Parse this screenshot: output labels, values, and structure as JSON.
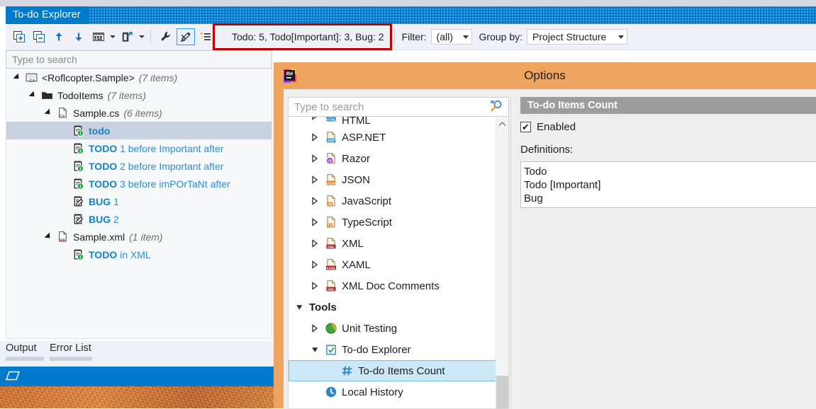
{
  "vs_window": {
    "title": "To-do Explorer",
    "toolbar": {
      "buttons": [
        {
          "name": "expand-all-icon",
          "label": "Expand All"
        },
        {
          "name": "collapse-all-icon",
          "label": "Collapse All"
        },
        {
          "name": "previous-item-icon",
          "label": "Previous Item"
        },
        {
          "name": "next-item-icon",
          "label": "Next Item"
        },
        {
          "name": "grouping-icon",
          "label": "Grouping"
        },
        {
          "name": "export-icon",
          "label": "Export"
        },
        {
          "name": "settings-wrench-icon",
          "label": "Settings"
        },
        {
          "name": "highlight-marker-icon",
          "label": "Highlight"
        },
        {
          "name": "sparkle-list-icon",
          "label": "Show Items"
        }
      ],
      "count_text": "Todo: 5, Todo[Important]: 3, Bug: 2",
      "filter_label": "Filter:",
      "filter_value": "(all)",
      "group_by_label": "Group by:",
      "group_by_value": "Project Structure"
    },
    "search": {
      "placeholder": "Type to search",
      "value": ""
    },
    "tree": [
      {
        "depth": 0,
        "twist": "open",
        "icon": "csharp-project-icon",
        "label": "<Roflcopter.Sample>",
        "meta": "(7 items)",
        "style": "plain",
        "selected": false
      },
      {
        "depth": 1,
        "twist": "open",
        "icon": "folder-icon",
        "label": "TodoItems",
        "meta": "(7 items)",
        "style": "plain",
        "selected": false
      },
      {
        "depth": 2,
        "twist": "open",
        "icon": "csharp-file-icon",
        "label": "Sample.cs",
        "meta": "(6 items)",
        "style": "plain",
        "selected": false
      },
      {
        "depth": 3,
        "twist": "none",
        "icon": "todo-item-icon",
        "keyword": "todo",
        "rest": "",
        "meta": "",
        "style": "todo",
        "selected": true
      },
      {
        "depth": 3,
        "twist": "none",
        "icon": "todo-item-icon",
        "keyword": "TODO",
        "rest": "1 before Important after",
        "meta": "",
        "style": "todo",
        "selected": false
      },
      {
        "depth": 3,
        "twist": "none",
        "icon": "todo-item-icon",
        "keyword": "TODO",
        "rest": "2 before Important after",
        "meta": "",
        "style": "todo",
        "selected": false
      },
      {
        "depth": 3,
        "twist": "none",
        "icon": "todo-item-icon",
        "keyword": "TODO",
        "rest": "3 before imPOrTaNt after",
        "meta": "",
        "style": "todo",
        "selected": false
      },
      {
        "depth": 3,
        "twist": "none",
        "icon": "bug-item-icon",
        "keyword": "BUG",
        "rest": "1",
        "meta": "",
        "style": "todo",
        "selected": false
      },
      {
        "depth": 3,
        "twist": "none",
        "icon": "bug-item-icon",
        "keyword": "BUG",
        "rest": "2",
        "meta": "",
        "style": "todo",
        "selected": false
      },
      {
        "depth": 2,
        "twist": "open",
        "icon": "xml-file-icon",
        "label": "Sample.xml",
        "meta": "(1 item)",
        "style": "plain",
        "selected": false
      },
      {
        "depth": 3,
        "twist": "none",
        "icon": "todo-item-icon",
        "keyword": "TODO",
        "rest": "in XML",
        "meta": "",
        "style": "todo",
        "selected": false
      }
    ],
    "bottom_tabs": [
      {
        "label": "Output"
      },
      {
        "label": "Error List"
      }
    ]
  },
  "options_dialog": {
    "logo_name": "resharper-logo-icon",
    "title": "Options",
    "search": {
      "placeholder": "Type to search",
      "value": ""
    },
    "tree": [
      {
        "depth": 1,
        "twist": "closed",
        "icon": "html-file-icon",
        "label": "HTML",
        "bold": false,
        "selected": false
      },
      {
        "depth": 1,
        "twist": "closed",
        "icon": "aspnet-file-icon",
        "label": "ASP.NET",
        "bold": false,
        "selected": false
      },
      {
        "depth": 1,
        "twist": "closed",
        "icon": "razor-file-icon",
        "label": "Razor",
        "bold": false,
        "selected": false
      },
      {
        "depth": 1,
        "twist": "closed",
        "icon": "json-file-icon",
        "label": "JSON",
        "bold": false,
        "selected": false
      },
      {
        "depth": 1,
        "twist": "closed",
        "icon": "javascript-file-icon",
        "label": "JavaScript",
        "bold": false,
        "selected": false
      },
      {
        "depth": 1,
        "twist": "closed",
        "icon": "typescript-file-icon",
        "label": "TypeScript",
        "bold": false,
        "selected": false
      },
      {
        "depth": 1,
        "twist": "closed",
        "icon": "xml-file-icon",
        "label": "XML",
        "bold": false,
        "selected": false
      },
      {
        "depth": 1,
        "twist": "closed",
        "icon": "xaml-file-icon",
        "label": "XAML",
        "bold": false,
        "selected": false
      },
      {
        "depth": 1,
        "twist": "closed",
        "icon": "xmldoc-file-icon",
        "label": "XML Doc Comments",
        "bold": false,
        "selected": false
      },
      {
        "depth": 0,
        "twist": "open",
        "icon": "none",
        "label": "Tools",
        "bold": true,
        "selected": false
      },
      {
        "depth": 1,
        "twist": "closed",
        "icon": "unit-testing-icon",
        "label": "Unit Testing",
        "bold": false,
        "selected": false
      },
      {
        "depth": 1,
        "twist": "open",
        "icon": "todo-explorer-icon",
        "label": "To-do Explorer",
        "bold": false,
        "selected": false
      },
      {
        "depth": 2,
        "twist": "none",
        "icon": "hash-count-icon",
        "label": "To-do Items Count",
        "bold": false,
        "selected": true
      },
      {
        "depth": 1,
        "twist": "none",
        "icon": "local-history-icon",
        "label": "Local History",
        "bold": false,
        "selected": false
      }
    ],
    "right_panel": {
      "section_title": "To-do Items Count",
      "enabled_label": "Enabled",
      "enabled_checked": true,
      "definitions_label": "Definitions:",
      "definitions": [
        "Todo",
        "Todo [Important]",
        "Bug"
      ]
    }
  },
  "colors": {
    "vs_accent": "#007acc",
    "highlight_box": "#c00000",
    "dialog_chrome": "#eda45f",
    "selection_blue": "#cce8f6",
    "keyword_blue": "#1183c6"
  }
}
